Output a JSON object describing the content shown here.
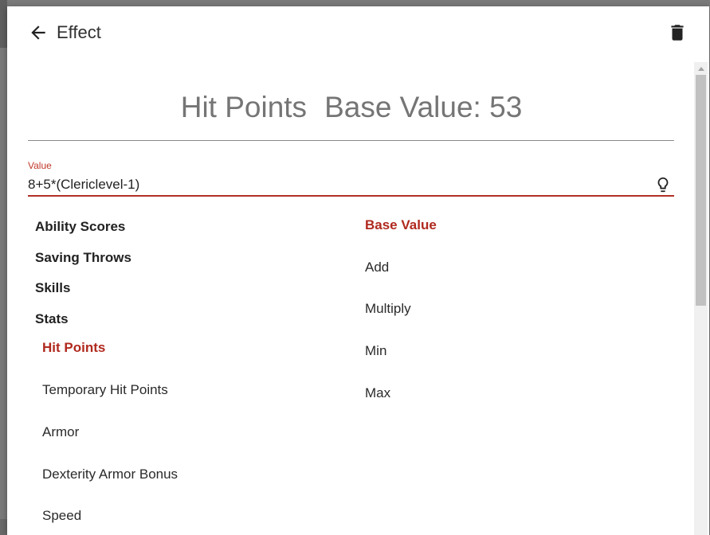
{
  "header": {
    "title": "Effect"
  },
  "heading": {
    "stat_name": "Hit Points",
    "base_value_text": "Base Value: 53"
  },
  "value_field": {
    "label": "Value",
    "value": "8+5*(Clericlevel-1)"
  },
  "categories": [
    {
      "label": "Ability Scores"
    },
    {
      "label": "Saving Throws"
    },
    {
      "label": "Skills"
    },
    {
      "label": "Stats"
    }
  ],
  "stats": [
    {
      "label": "Hit Points",
      "selected": true
    },
    {
      "label": "Temporary Hit Points"
    },
    {
      "label": "Armor"
    },
    {
      "label": "Dexterity Armor Bonus"
    },
    {
      "label": "Speed"
    }
  ],
  "operations": [
    {
      "label": "Base Value",
      "selected": true
    },
    {
      "label": "Add"
    },
    {
      "label": "Multiply"
    },
    {
      "label": "Min"
    },
    {
      "label": "Max"
    }
  ],
  "icons": {
    "back": "arrow-left-icon",
    "delete": "trash-icon",
    "hint": "lightbulb-icon"
  },
  "colors": {
    "accent": "#b0291e",
    "heading": "#757575"
  }
}
